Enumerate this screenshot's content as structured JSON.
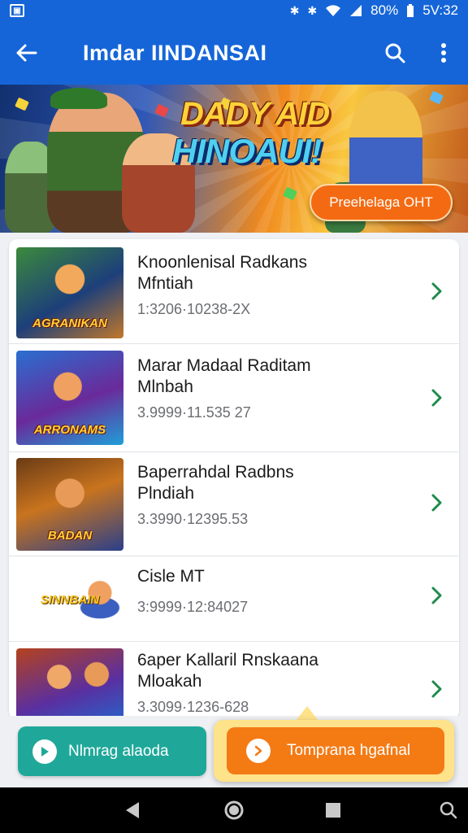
{
  "status_bar": {
    "battery": "80%",
    "time": "5V:32"
  },
  "app_bar": {
    "title": "Imdar IINDANSAI"
  },
  "banner": {
    "logo_line1": "DADY AID",
    "logo_line2": "HINOAUI!",
    "cta_label": "Preehelaga OHT"
  },
  "list": {
    "items": [
      {
        "title_line1": "Knoonlenisal Radkans",
        "title_line2": "Mfntiah",
        "meta": "1:3206·10238-2X",
        "thumb_label": "AGRANIKAN"
      },
      {
        "title_line1": "Marar Madaal Raditam",
        "title_line2": "Mlnbah",
        "meta": "3.9999·11.535 27",
        "thumb_label": "ARRONAMS"
      },
      {
        "title_line1": "Baperrahdal Radbns",
        "title_line2": "Plndiah",
        "meta": "3.3990·12395.53",
        "thumb_label": "BADAN"
      },
      {
        "title_line1": "Cisle MT",
        "title_line2": "",
        "meta": "3:9999·12:84027",
        "thumb_label": "SINNBAIN"
      },
      {
        "title_line1": "6aper Kallaril Rnskaana",
        "title_line2": "Mloakah",
        "meta": "3.3099·1236-628",
        "thumb_label": ""
      }
    ]
  },
  "bottom_actions": {
    "left_label": "Nlmrag alaoda",
    "right_label": "Tomprana hgafnal"
  },
  "colors": {
    "app_bar": "#1565d8",
    "chevron": "#1f8a4c",
    "left_button": "#1fa89a",
    "right_button": "#f47a14",
    "right_button_highlight": "#ffe38a"
  }
}
